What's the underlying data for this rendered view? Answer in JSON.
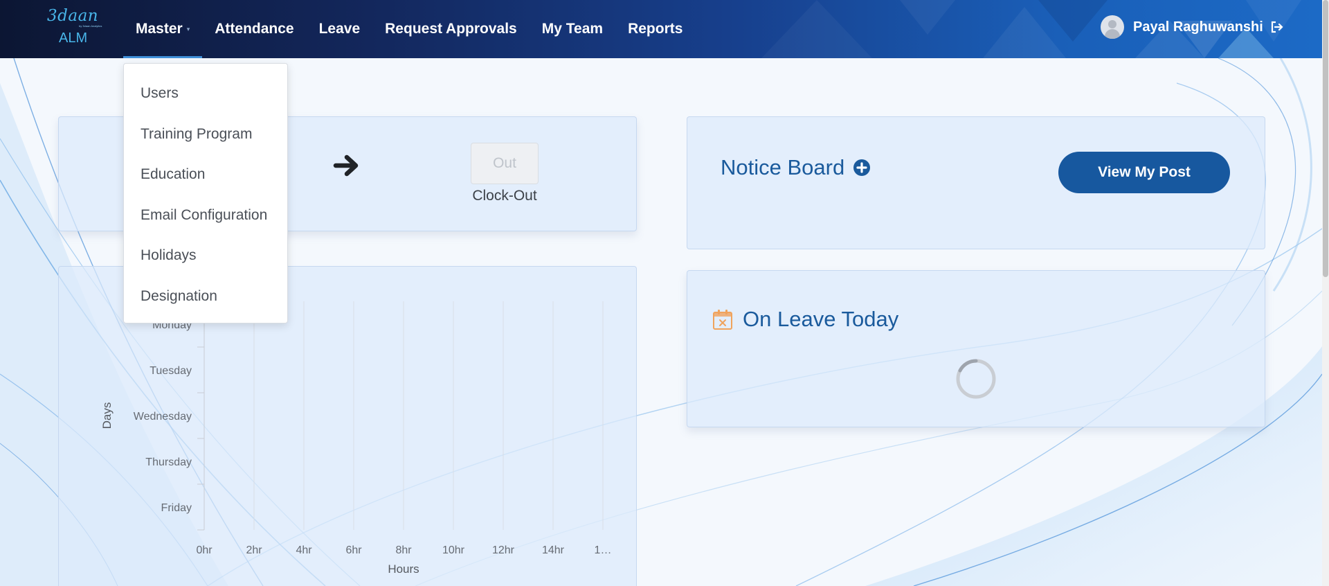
{
  "brand": {
    "script": "3daan",
    "tagline": "by 3daan Analytics",
    "subtitle": "ALM"
  },
  "nav": {
    "items": [
      {
        "label": "Master",
        "active": true
      },
      {
        "label": "Attendance"
      },
      {
        "label": "Leave"
      },
      {
        "label": "Request Approvals"
      },
      {
        "label": "My Team"
      },
      {
        "label": "Reports"
      }
    ]
  },
  "user": {
    "name": "Payal Raghuwanshi",
    "avatar_icon": "user-avatar-icon",
    "logout_icon": "sign-out-icon"
  },
  "master_dropdown": {
    "items": [
      {
        "label": "Users"
      },
      {
        "label": "Training Program"
      },
      {
        "label": "Education"
      },
      {
        "label": "Email Configuration"
      },
      {
        "label": "Holidays"
      },
      {
        "label": "Designation"
      }
    ]
  },
  "clock": {
    "arrow_icon": "arrow-right-icon",
    "out_button": "Out",
    "out_caption": "Clock-Out",
    "out_disabled": true
  },
  "notice_board": {
    "title": "Notice Board",
    "add_icon": "plus-circle-icon",
    "view_button": "View My Post"
  },
  "on_leave": {
    "title": "On Leave Today",
    "icon": "calendar-x-icon",
    "loading": true
  },
  "colors": {
    "navbar_dark": "#0c1633",
    "navbar_light": "#1c6ac6",
    "accent": "#17589f",
    "title": "#1a5a9c",
    "card_bg": "#dde9fb"
  },
  "chart_data": {
    "type": "bar",
    "orientation": "horizontal",
    "title": "",
    "xlabel": "Hours",
    "ylabel": "Days",
    "categories": [
      "Monday",
      "Tuesday",
      "Wednesday",
      "Thursday",
      "Friday"
    ],
    "x_ticks": [
      "0hr",
      "2hr",
      "4hr",
      "6hr",
      "8hr",
      "10hr",
      "12hr",
      "14hr",
      "1…"
    ],
    "series": [
      {
        "values": [
          0,
          0,
          0,
          0,
          0
        ]
      }
    ],
    "grid": true
  }
}
